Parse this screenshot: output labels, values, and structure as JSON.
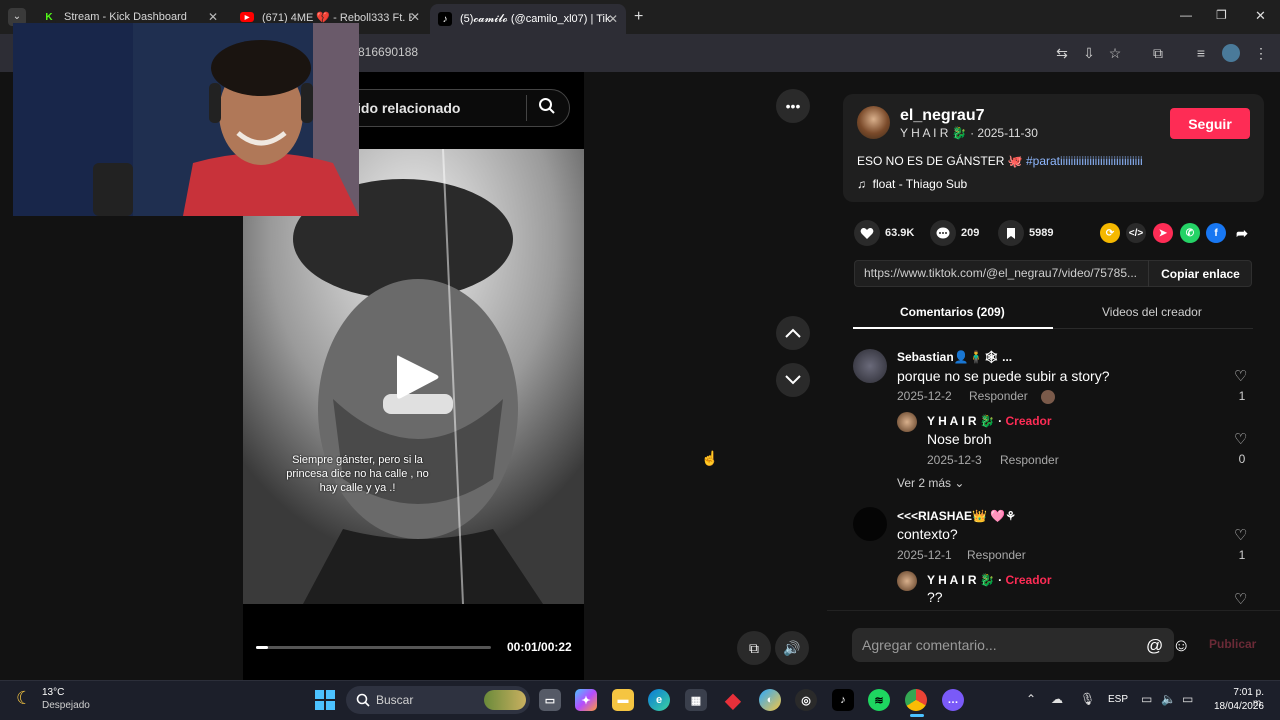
{
  "tabs": [
    {
      "title": "Stream - Kick Dashboard",
      "icon": "kick-icon"
    },
    {
      "title": "(671) 4ME 💔 - Reboll333 Ft. E:",
      "icon": "youtube-icon"
    },
    {
      "title": "(5)𝓬𝓪𝓶𝓲𝓵𝓸 (@camilo_xl07) | Tik",
      "icon": "tiktok-icon"
    }
  ],
  "address": "816690188",
  "player": {
    "search_placeholder": "ido relacionado",
    "caption": "Siempre gánster, pero si la princesa dice no ha calle , no hay calle y ya .!",
    "time": "00:01/00:22",
    "progress": 0.05
  },
  "post": {
    "author": "el_negrau7",
    "subtitle": "Y H A I R 🐉 · 2025-11-30",
    "follow_label": "Seguir",
    "desc_text": "ESO NO ES DE GÁNSTER 🐙 ",
    "desc_tag": "#paratiiiiiiiiiiiiiiiiiiiiiiiiiiiiiii",
    "music": "float - Thiago Sub",
    "likes": "63.9K",
    "comments": "209",
    "saves": "5989",
    "link": "https://www.tiktok.com/@el_negrau7/video/75785...",
    "copy_label": "Copiar enlace"
  },
  "panel_tabs": {
    "comments": "Comentarios (209)",
    "creator_videos": "Videos del creador"
  },
  "comments": [
    {
      "name": "Sebastian👤🧍‍♂️🕸 ...",
      "text": "porque no se puede subir a story?",
      "date": "2025-12-2",
      "reply": "Responder",
      "likes": "1"
    },
    {
      "name": "Y H A I R 🐉 · ",
      "badge": "Creador",
      "text": "Nose broh",
      "date": "2025-12-3",
      "reply": "Responder",
      "likes": "0"
    },
    {
      "name": "<<<RIASHAE👑 🩷⚘",
      "text": "contexto?",
      "date": "2025-12-1",
      "reply": "Responder",
      "likes": "1"
    },
    {
      "name": "Y H A I R 🐉 · ",
      "badge": "Creador",
      "text": "??"
    }
  ],
  "more_replies": "Ver 2 más",
  "comment_input": {
    "placeholder": "Agregar comentario...",
    "publish": "Publicar"
  },
  "taskbar": {
    "temp": "13°C",
    "weather": "Despejado",
    "search": "Buscar",
    "lang": "ESP",
    "time": "7:01 p. m.",
    "date": "18/04/2026"
  },
  "colors": {
    "accent": "#fe2c55",
    "tag": "#8fb8ff"
  }
}
